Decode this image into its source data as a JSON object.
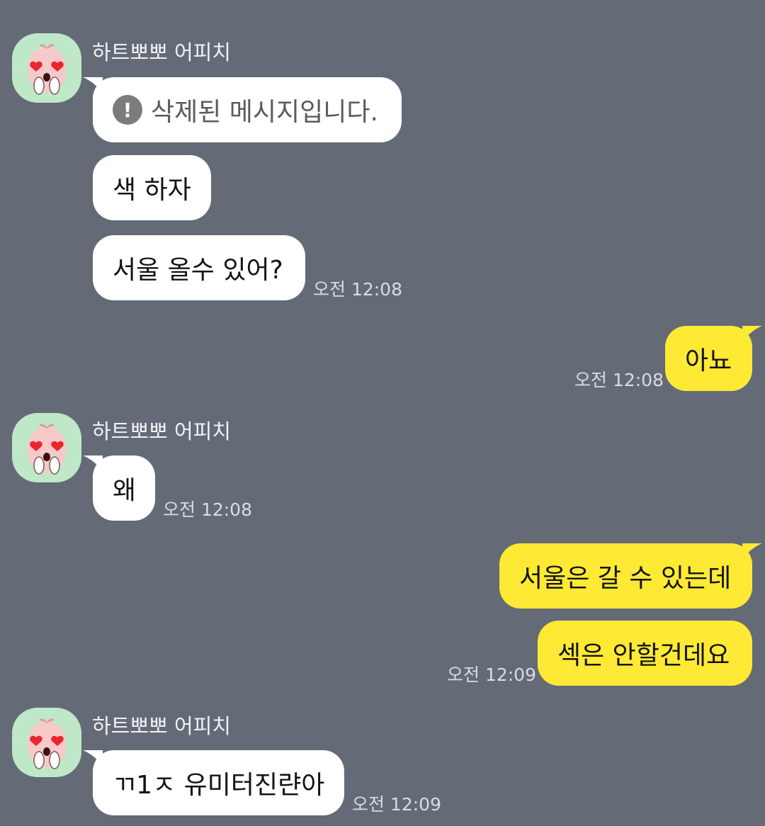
{
  "chat": {
    "sender_name": "하트뽀뽀 어피치",
    "deleted_text": "삭제된 메시지입니다.",
    "deleted_icon": "exclamation-circle-icon",
    "avatar_icon": "apeach-heart-eyes-avatar-icon",
    "colors": {
      "background": "#656b76",
      "incoming_bubble": "#ffffff",
      "outgoing_bubble": "#fee934",
      "avatar_bg": "#bfe8c8"
    },
    "messages": [
      {
        "text": "삭제된 메시지입니다.",
        "dir": "in"
      },
      {
        "text": "색 하자",
        "dir": "in"
      },
      {
        "text": "서울 올수 있어?",
        "dir": "in",
        "time": "오전 12:08"
      },
      {
        "text": "아뇨",
        "dir": "out",
        "time": "오전 12:08"
      },
      {
        "text": "왜",
        "dir": "in",
        "time": "오전 12:08"
      },
      {
        "text": "서울은 갈 수 있는데",
        "dir": "out"
      },
      {
        "text": "섹은 안할건데요",
        "dir": "out",
        "time": "오전 12:09"
      },
      {
        "text": "ㄲ1ㅈ 유미터진랸아",
        "dir": "in",
        "time": "오전 12:09"
      }
    ]
  }
}
